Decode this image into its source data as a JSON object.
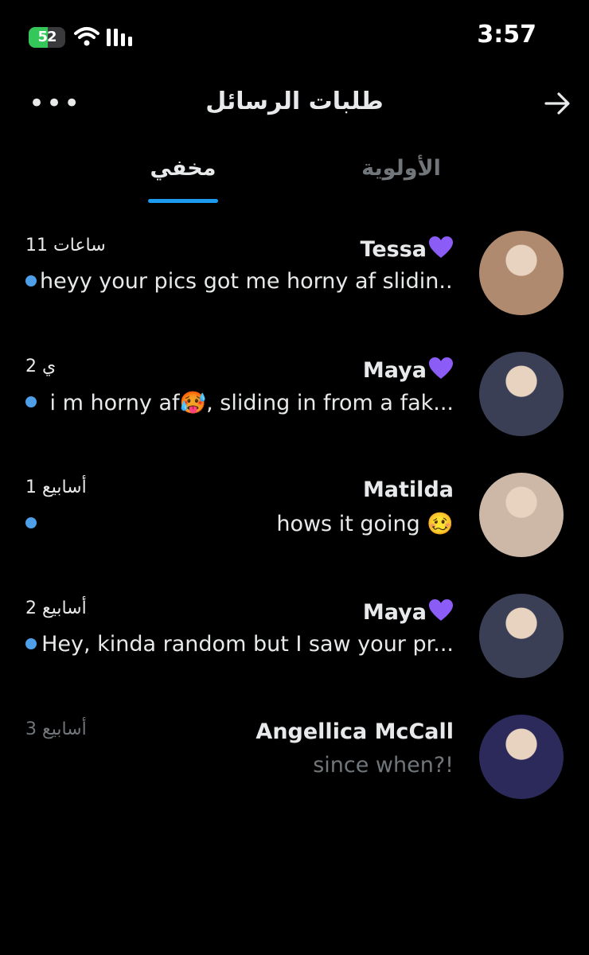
{
  "status_bar": {
    "battery": "52",
    "battery_level": 0.52,
    "time": "3:57"
  },
  "header": {
    "title": "طلبات الرسائل",
    "more_icon": "more-dots-icon",
    "back_icon": "arrow-right-icon"
  },
  "tabs": [
    {
      "label": "مخفي",
      "active": true
    },
    {
      "label": "الأولوية",
      "active": false
    }
  ],
  "colors": {
    "accent": "#1d9bf0",
    "unread_dot": "#4f9ee8",
    "muted": "#71767b",
    "heart": "#8b5cf6"
  },
  "conversations": [
    {
      "name": "Tessa",
      "heart": true,
      "time": "11 ساعات",
      "preview": "heyy your pics got me horny af slidin...",
      "unread": true,
      "avatar_color": "#b08a6e"
    },
    {
      "name": "Maya",
      "heart": true,
      "time": "2 ي",
      "preview": "i m horny af🥵, sliding in from a fak...",
      "unread": true,
      "avatar_color": "#3a3f55"
    },
    {
      "name": "Matilda",
      "heart": false,
      "time": "1 أسابيع",
      "preview": "hows it going 🥴",
      "unread": true,
      "avatar_color": "#cdb8a8"
    },
    {
      "name": "Maya",
      "heart": true,
      "time": "2 أسابيع",
      "preview": "Hey, kinda random but I saw your pr...",
      "unread": true,
      "avatar_color": "#3a3f55"
    },
    {
      "name": "Angellica McCall",
      "heart": false,
      "time": "3 أسابيع",
      "preview": "since when?!",
      "unread": false,
      "avatar_color": "#2b2a5a"
    }
  ]
}
